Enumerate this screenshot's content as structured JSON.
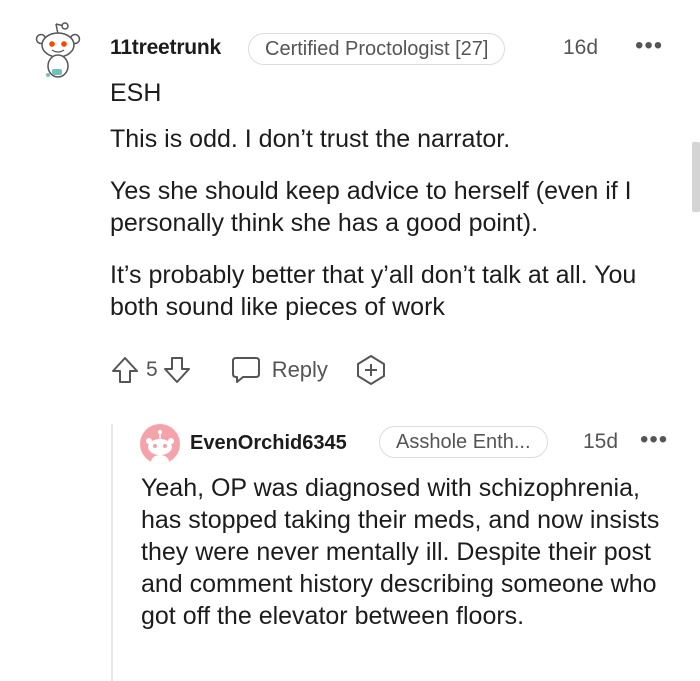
{
  "comment": {
    "author": "11treetrunk",
    "flair": "Certified Proctologist [27]",
    "time": "16d",
    "more": "•••",
    "paragraphs": [
      "ESH",
      "This is odd. I don’t trust the narrator.",
      "Yes she should keep advice to herself (even if I personally think she has a good point).",
      "It’s probably better that y’all don’t talk at all. You both sound like pieces of work"
    ],
    "votes": "5",
    "reply_label": "Reply"
  },
  "reply": {
    "author": "EvenOrchid6345",
    "flair": "Asshole Enth...",
    "time": "15d",
    "more": "•••",
    "text": "Yeah, OP was diagnosed with schizophrenia, has stopped taking their meds, and now insists they were never mentally ill. Despite their post and comment history describing someone who got off the elevator between floors."
  },
  "colors": {
    "text": "#1c1c1c",
    "meta": "#555555",
    "border": "#dadce0",
    "avatar_accent": "#ff4500",
    "avatar2_bg": "#f4a3ab"
  }
}
